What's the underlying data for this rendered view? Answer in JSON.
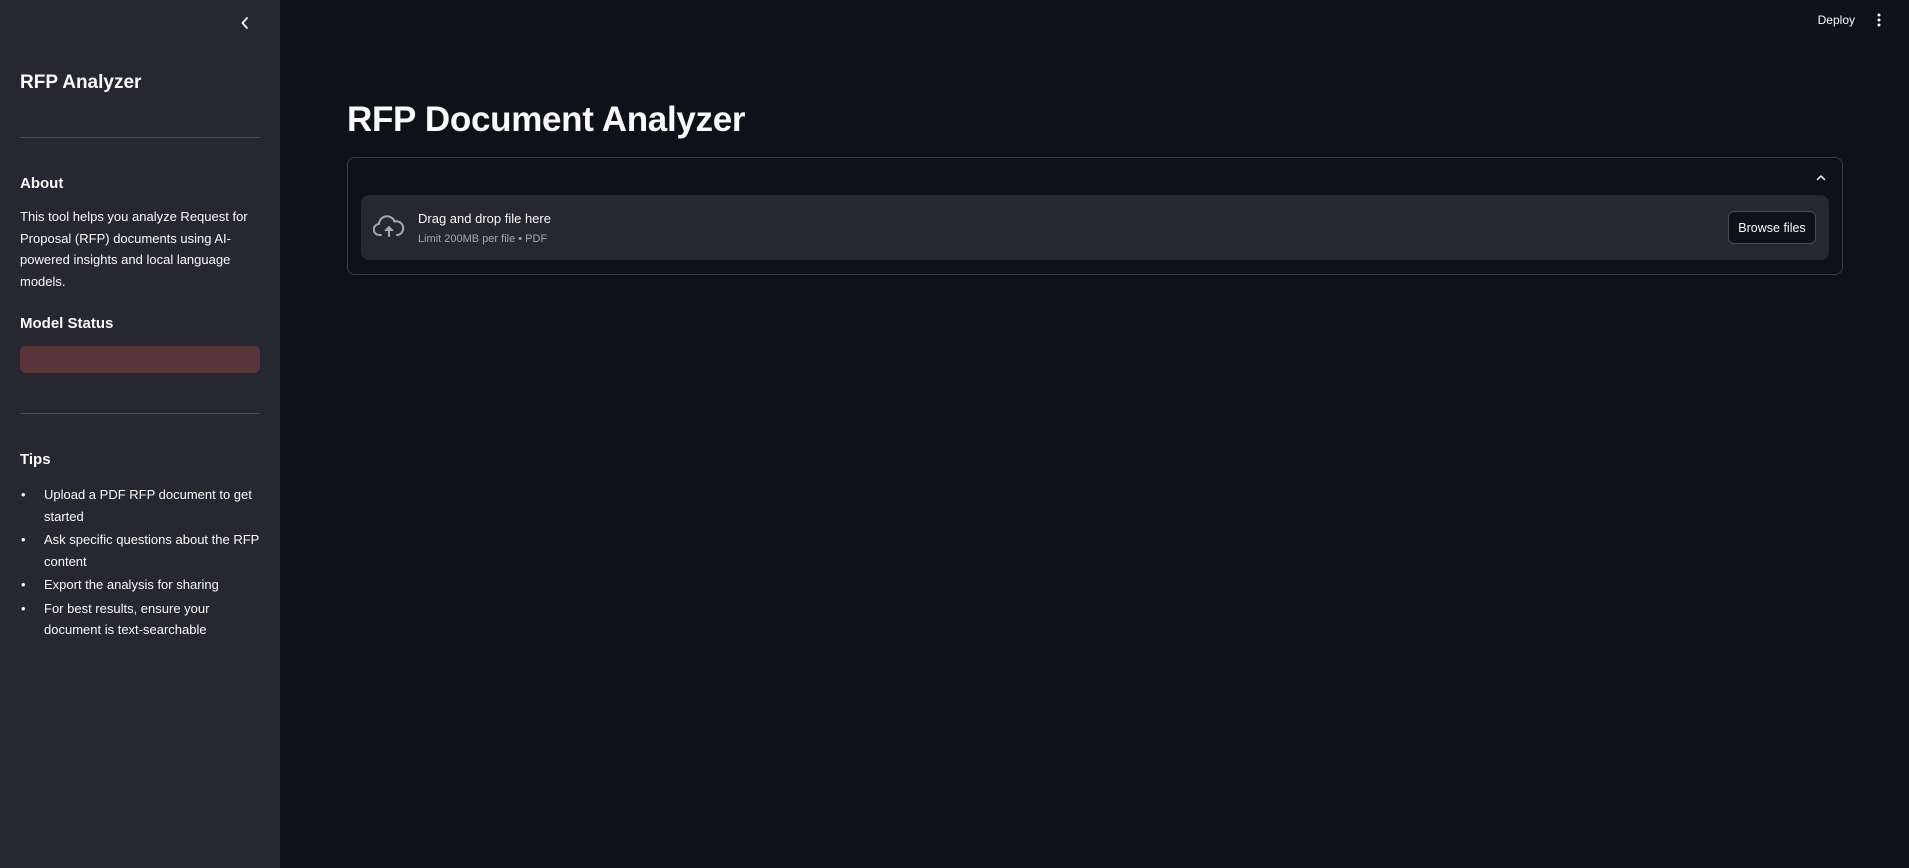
{
  "sidebar": {
    "title": "RFP Analyzer",
    "about_heading": "About",
    "about_text": "This tool helps you analyze Request for Proposal (RFP) documents using AI-powered insights and local language models.",
    "model_status_heading": "Model Status",
    "tips_heading": "Tips",
    "tips": [
      "Upload a PDF RFP document to get started",
      "Ask specific questions about the RFP content",
      "Export the analysis for sharing",
      "For best results, ensure your document is text-searchable"
    ],
    "bullet": "•"
  },
  "header": {
    "deploy_label": "Deploy",
    "menu_icon": "kebab-menu-icon"
  },
  "main": {
    "title": "RFP Document Analyzer",
    "uploader": {
      "drag_text": "Drag and drop file here",
      "limit_text": "Limit 200MB per file • PDF",
      "browse_label": "Browse files",
      "icon": "cloud-upload-icon"
    }
  },
  "colors": {
    "background": "#0e1117",
    "sidebar": "#262730",
    "status_box": "#59353b",
    "text": "#fafafa"
  }
}
